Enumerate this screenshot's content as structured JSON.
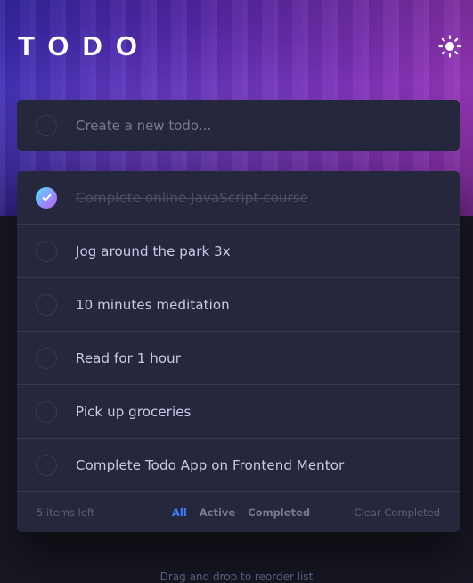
{
  "app": {
    "title": "TODO"
  },
  "new_todo": {
    "placeholder": "Create a new todo..."
  },
  "todos": [
    {
      "text": "Complete online JavaScript course",
      "completed": true
    },
    {
      "text": "Jog around the park 3x",
      "completed": false
    },
    {
      "text": "10 minutes meditation",
      "completed": false
    },
    {
      "text": "Read for 1 hour",
      "completed": false
    },
    {
      "text": "Pick up groceries",
      "completed": false
    },
    {
      "text": "Complete Todo App on Frontend Mentor",
      "completed": false
    }
  ],
  "footer": {
    "items_left": "5 items left",
    "filters": [
      "All",
      "Active",
      "Completed"
    ],
    "active_filter": "All",
    "clear": "Clear Completed"
  },
  "hint": "Drag and drop to reorder list",
  "icons": {
    "theme_toggle": "sun-icon",
    "check": "check-icon"
  },
  "colors": {
    "accent": "#3a7cfd",
    "card": "#25273d",
    "background": "#171823",
    "check_start": "#55ddff",
    "check_end": "#c058f3"
  }
}
